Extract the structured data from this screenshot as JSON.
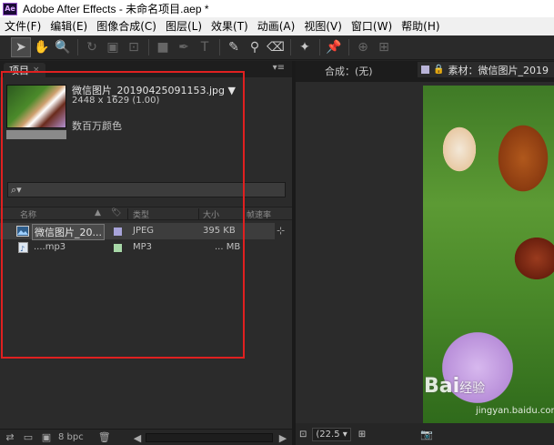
{
  "window": {
    "title": "Adobe After Effects - 未命名项目.aep *",
    "logo": "Ae"
  },
  "menu": [
    "文件(F)",
    "编辑(E)",
    "图像合成(C)",
    "图层(L)",
    "效果(T)",
    "动画(A)",
    "视图(V)",
    "窗口(W)",
    "帮助(H)"
  ],
  "project": {
    "tab_label": "项目",
    "tab_close": "×",
    "menu_glyph": "▾≡",
    "preview": {
      "name": "微信图片_20190425091153.jpg ▼",
      "dimensions": "2448 x 1629 (1.00)",
      "color_depth": "数百万颜色"
    },
    "search_glyph": "⌕▾",
    "columns": {
      "name": "名称",
      "type": "类型",
      "size": "大小",
      "frame_rate": "帧速率"
    },
    "items": [
      {
        "name": "微信图片_20...",
        "type": "JPEG",
        "size": "395 KB",
        "label_color": "#a7a3d9"
      },
      {
        "name": "....mp3",
        "type": "MP3",
        "size": "... MB",
        "label_color": "#a8d8a8"
      }
    ],
    "bpc": "8 bpc"
  },
  "composition": {
    "tab_label": "合成：(无)",
    "zoom": "(22.5 ▾"
  },
  "footage": {
    "tab_label": "素材：微信图片_2019"
  },
  "watermark": {
    "brand": "Bai",
    "brand_suffix": "经验",
    "url": "jingyan.baidu.com"
  }
}
